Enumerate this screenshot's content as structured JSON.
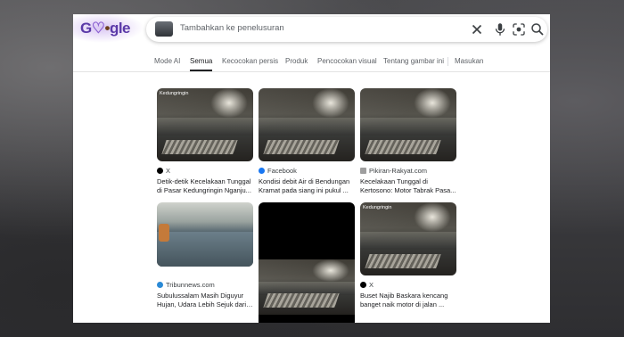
{
  "search": {
    "placeholder": "Tambahkan ke penelusuran"
  },
  "tabs": [
    {
      "label": "Mode AI"
    },
    {
      "label": "Semua"
    },
    {
      "label": "Kecocokan persis"
    },
    {
      "label": "Produk"
    },
    {
      "label": "Pencocokan visual"
    },
    {
      "label": "Tentang gambar ini"
    },
    {
      "label": "Masukan"
    }
  ],
  "results": [
    {
      "source": "X",
      "title1": "Detik-detik Kecelakaan Tunggal",
      "title2": "di Pasar Kedungringin Nganju...",
      "overlay": "Kedungringin"
    },
    {
      "source": "Facebook",
      "title1": "Kondisi debit Air di Bendungan",
      "title2": "Kramat pada siang ini pukul ..."
    },
    {
      "source": "Pikiran-Rakyat.com",
      "title1": "Kecelakaan Tunggal di",
      "title2": "Kertosono: Motor Tabrak Pasa..."
    },
    {
      "source": "Tribunnews.com",
      "title1": "Subulussalam Masih Diguyur",
      "title2": "Hujan, Udara Lebih Sejuk dari ..."
    },
    {
      "source": "X",
      "title1": "Buset Najib Baskara kencang",
      "title2": "banget naik motor di jalan ...",
      "overlay": "Kedungringin"
    }
  ],
  "colors": {
    "x": "#000000",
    "facebook": "#1877f2",
    "pikiran": "#9e9e9e",
    "tribun": "#2b8ad6"
  }
}
